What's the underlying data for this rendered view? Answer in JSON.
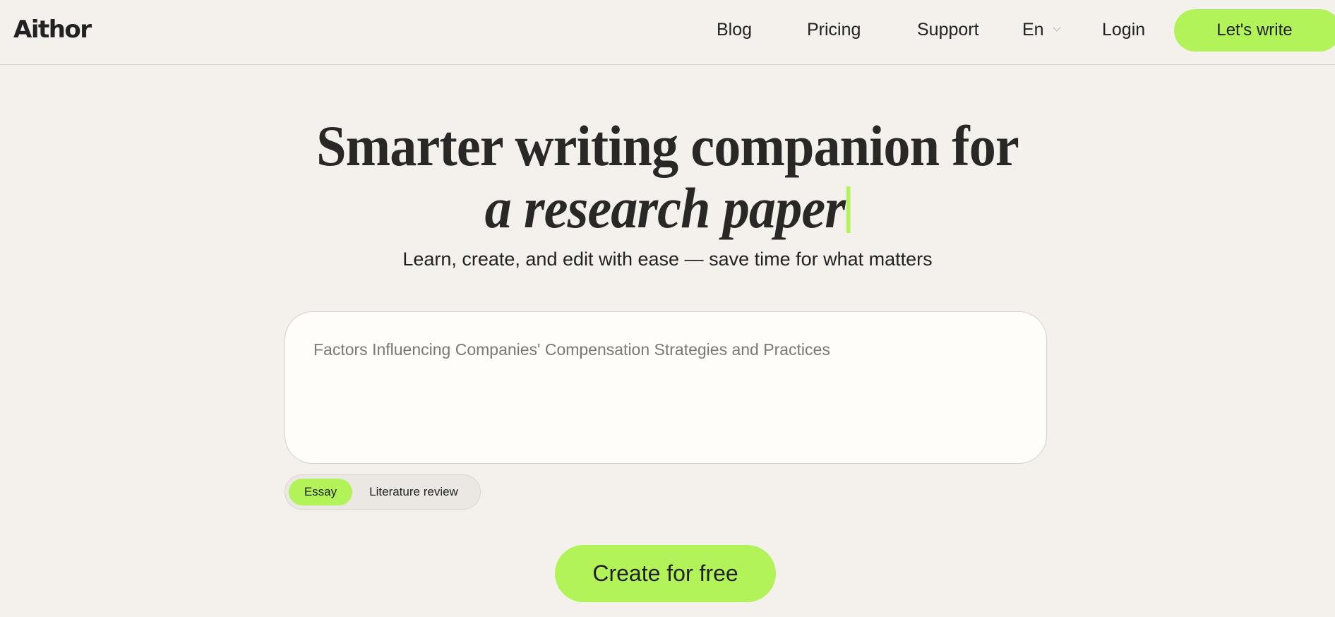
{
  "header": {
    "logo": "Aithor",
    "nav": {
      "blog": "Blog",
      "pricing": "Pricing",
      "support": "Support",
      "language": "En",
      "login": "Login"
    },
    "cta_label": "Let's write"
  },
  "hero": {
    "title_line1": "Smarter writing companion for",
    "title_line2": "a research paper",
    "subtitle": "Learn, create, and edit with ease — save time for what matters"
  },
  "prompt": {
    "placeholder": "Factors Influencing Companies' Compensation Strategies and Practices",
    "value": ""
  },
  "modes": {
    "selected": "Essay",
    "options": [
      "Essay",
      "Literature review"
    ]
  },
  "create_button_label": "Create for free",
  "colors": {
    "accent": "#b3f35a",
    "background": "#f4f0eb",
    "text": "#222222"
  }
}
